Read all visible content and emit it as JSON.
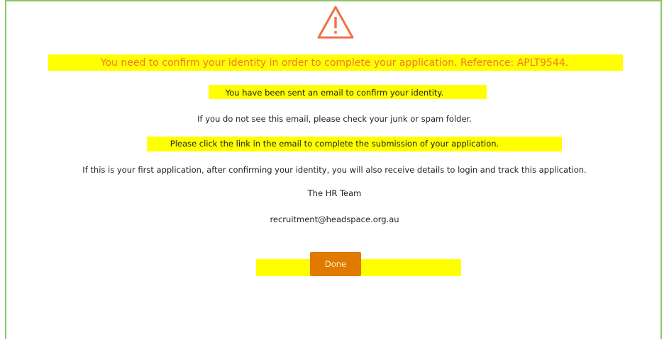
{
  "colors": {
    "frame_border": "#8cc665",
    "warning_icon": "#f07045",
    "headline_text": "#f2772e",
    "highlight": "#ffff00",
    "button_bg": "#e07a00"
  },
  "icon": "warning-triangle-icon",
  "headline": "You need to confirm your identity in order to complete your application. Reference: APLT9544.",
  "messages": {
    "email_sent": "You have been sent an email to confirm your identity.",
    "junk_notice": "If you do not see this email, please check your junk or spam folder.",
    "click_link": "Please click the link in the email to complete the submission of your application.",
    "first_application": "If this is your first application, after confirming your identity, you will also receive details to login and track this application."
  },
  "signature": {
    "team": "The HR Team",
    "email": "recruitment@headspace.org.au"
  },
  "done_button": {
    "label": "Done"
  }
}
